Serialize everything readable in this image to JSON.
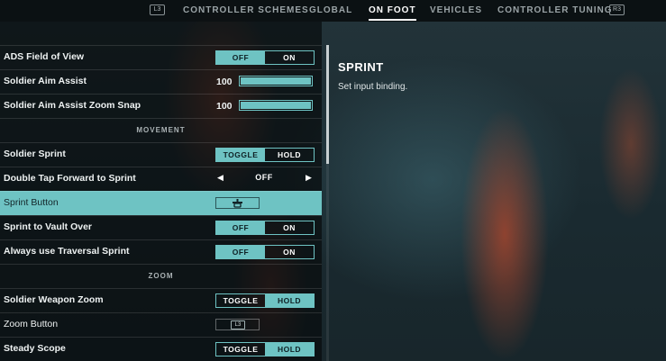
{
  "tabs": [
    {
      "label": "CONTROLLER SCHEMES",
      "active": false
    },
    {
      "label": "GLOBAL",
      "active": false
    },
    {
      "label": "ON FOOT",
      "active": true
    },
    {
      "label": "VEHICLES",
      "active": false
    },
    {
      "label": "CONTROLLER TUNING",
      "active": false
    }
  ],
  "hints": {
    "prev": "L3",
    "next": "R3"
  },
  "settings": {
    "ads_fov": {
      "label": "ADS Field of View",
      "options": [
        "OFF",
        "ON"
      ],
      "selected": "OFF"
    },
    "aim_assist": {
      "label": "Soldier Aim Assist",
      "value": "100",
      "level": 1.0
    },
    "aim_assist_snap": {
      "label": "Soldier Aim Assist Zoom Snap",
      "value": "100",
      "level": 1.0
    },
    "movement_header": "MOVEMENT",
    "soldier_sprint": {
      "label": "Soldier Sprint",
      "options": [
        "TOGGLE",
        "HOLD"
      ],
      "selected": "TOGGLE"
    },
    "double_tap": {
      "label": "Double Tap Forward to Sprint",
      "value": "OFF"
    },
    "sprint_button": {
      "label": "Sprint Button",
      "binding_icon": "controller-stick-icon"
    },
    "sprint_vault": {
      "label": "Sprint to Vault Over",
      "options": [
        "OFF",
        "ON"
      ],
      "selected": "OFF"
    },
    "traversal_sprint": {
      "label": "Always use Traversal Sprint",
      "options": [
        "OFF",
        "ON"
      ],
      "selected": "OFF"
    },
    "zoom_header": "ZOOM",
    "weapon_zoom": {
      "label": "Soldier Weapon Zoom",
      "options": [
        "TOGGLE",
        "HOLD"
      ],
      "selected": "HOLD"
    },
    "zoom_button": {
      "label": "Zoom Button",
      "binding": "L3"
    },
    "steady_scope": {
      "label": "Steady Scope",
      "options": [
        "TOGGLE",
        "HOLD"
      ],
      "selected": "HOLD"
    }
  },
  "info": {
    "title": "SPRINT",
    "description": "Set input binding."
  },
  "colors": {
    "accent": "#6ec3c3",
    "panel": "#080c0e"
  }
}
